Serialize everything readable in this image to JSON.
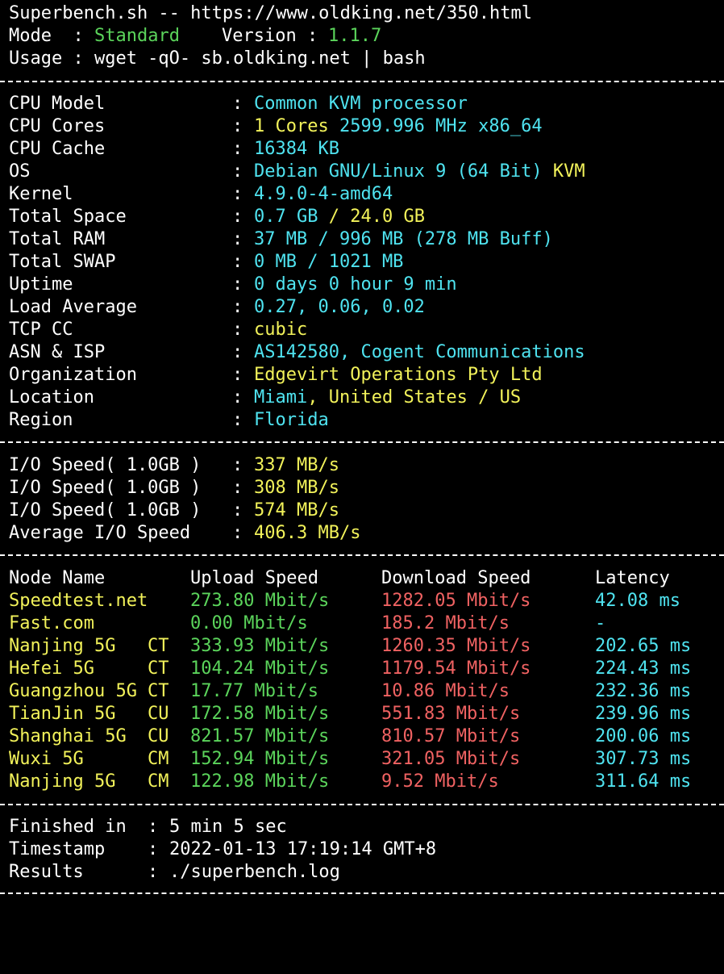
{
  "colors": {
    "background": "#000000",
    "text": "#ffffff",
    "green": "#5bd45b",
    "cyan": "#4fe3f0",
    "yellow": "#f2f25a",
    "red": "#f06262"
  },
  "header": {
    "title": "Superbench.sh -- https://www.oldking.net/350.html",
    "mode_label": "Mode  : ",
    "mode_value": "Standard",
    "version_label": "Version : ",
    "version_value": "1.1.7",
    "usage": "Usage : wget -qO- sb.oldking.net | bash"
  },
  "system": {
    "rows": [
      {
        "label": "CPU Model",
        "value": "Common KVM processor"
      },
      {
        "label": "CPU Cores",
        "value": "1 Cores 2599.996 MHz x86_64"
      },
      {
        "label": "CPU Cache",
        "value": "16384 KB"
      },
      {
        "label": "OS",
        "value": "Debian GNU/Linux 9 (64 Bit)",
        "value_extra": "KVM"
      },
      {
        "label": "Kernel",
        "value": "4.9.0-4-amd64"
      },
      {
        "label": "Total Space",
        "value": "0.7 GB / 24.0 GB"
      },
      {
        "label": "Total RAM",
        "value": "37 MB / 996 MB (278 MB Buff)"
      },
      {
        "label": "Total SWAP",
        "value": "0 MB / 1021 MB"
      },
      {
        "label": "Uptime",
        "value": "0 days 0 hour 9 min"
      },
      {
        "label": "Load Average",
        "value": "0.27, 0.06, 0.02"
      },
      {
        "label": "TCP CC",
        "value": "cubic"
      },
      {
        "label": "ASN & ISP",
        "value": "AS142580, Cogent Communications"
      },
      {
        "label": "Organization",
        "value": "Edgevirt Operations Pty Ltd"
      },
      {
        "label": "Location",
        "value": "Miami, United States / US"
      },
      {
        "label": "Region",
        "value": "Florida"
      }
    ]
  },
  "io": {
    "rows": [
      {
        "label": "I/O Speed( 1.0GB )",
        "value": "337 MB/s"
      },
      {
        "label": "I/O Speed( 1.0GB )",
        "value": "308 MB/s"
      },
      {
        "label": "I/O Speed( 1.0GB )",
        "value": "574 MB/s"
      },
      {
        "label": "Average I/O Speed",
        "value": "406.3 MB/s"
      }
    ]
  },
  "speedtest": {
    "headers": {
      "node": "Node Name",
      "upload": "Upload Speed",
      "download": "Download Speed",
      "latency": "Latency"
    },
    "rows": [
      {
        "node": "Speedtest.net",
        "isp": "",
        "upload": "273.80 Mbit/s",
        "download": "1282.05 Mbit/s",
        "latency": "42.08 ms"
      },
      {
        "node": "Fast.com",
        "isp": "",
        "upload": "0.00 Mbit/s",
        "download": "185.2 Mbit/s",
        "latency": "-"
      },
      {
        "node": "Nanjing 5G",
        "isp": "CT",
        "upload": "333.93 Mbit/s",
        "download": "1260.35 Mbit/s",
        "latency": "202.65 ms"
      },
      {
        "node": "Hefei 5G",
        "isp": "CT",
        "upload": "104.24 Mbit/s",
        "download": "1179.54 Mbit/s",
        "latency": "224.43 ms"
      },
      {
        "node": "Guangzhou 5G",
        "isp": "CT",
        "upload": "17.77 Mbit/s",
        "download": "10.86 Mbit/s",
        "latency": "232.36 ms"
      },
      {
        "node": "TianJin 5G",
        "isp": "CU",
        "upload": "172.58 Mbit/s",
        "download": "551.83 Mbit/s",
        "latency": "239.96 ms"
      },
      {
        "node": "Shanghai 5G",
        "isp": "CU",
        "upload": "821.57 Mbit/s",
        "download": "810.57 Mbit/s",
        "latency": "200.06 ms"
      },
      {
        "node": "Wuxi 5G",
        "isp": "CM",
        "upload": "152.94 Mbit/s",
        "download": "321.05 Mbit/s",
        "latency": "307.73 ms"
      },
      {
        "node": "Nanjing 5G",
        "isp": "CM",
        "upload": "122.98 Mbit/s",
        "download": "9.52 Mbit/s",
        "latency": "311.64 ms"
      }
    ]
  },
  "footer": {
    "rows": [
      {
        "label": "Finished in",
        "value": "5 min 5 sec"
      },
      {
        "label": "Timestamp",
        "value": "2022-01-13 17:19:14 GMT+8"
      },
      {
        "label": "Results",
        "value": "./superbench.log"
      }
    ]
  }
}
